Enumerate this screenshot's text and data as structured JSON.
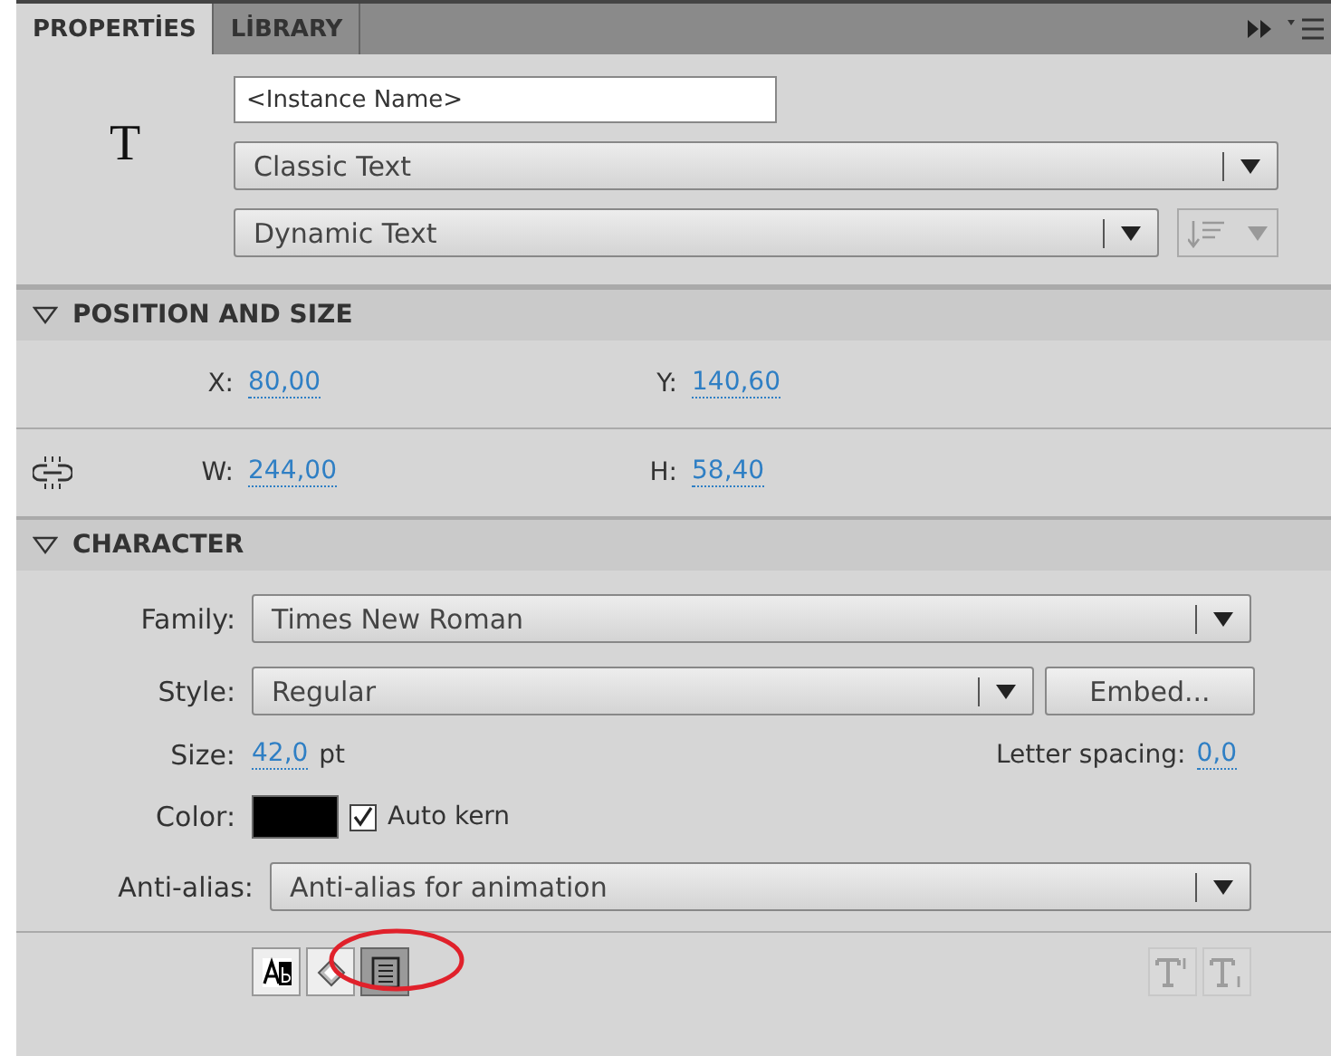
{
  "tabs": [
    {
      "label": "PROPERTİES",
      "selected": true
    },
    {
      "label": "LİBRARY",
      "selected": false
    }
  ],
  "header": {
    "icon_glyph": "T",
    "instance_name": {
      "placeholder": "<Instance Name>"
    },
    "text_engine": "Classic Text",
    "text_type": "Dynamic Text"
  },
  "sections": [
    {
      "kind": "position",
      "title": "POSITION AND SIZE",
      "expanded": true,
      "rows": [
        [
          {
            "label": "X:",
            "value": "80,00"
          },
          {
            "label": "Y:",
            "value": "140,60"
          }
        ],
        [
          {
            "label": "W:",
            "value": "244,00"
          },
          {
            "label": "H:",
            "value": "58,40"
          }
        ]
      ]
    },
    {
      "kind": "character",
      "title": "CHARACTER",
      "expanded": true,
      "family": {
        "label": "Family:",
        "value": "Times New Roman"
      },
      "style": {
        "label": "Style:",
        "value": "Regular",
        "button": "Embed..."
      },
      "size": {
        "label": "Size:",
        "value": "42,0",
        "unit": "pt"
      },
      "letter_spacing": {
        "label": "Letter spacing:",
        "value": "0,0"
      },
      "color": {
        "label": "Color:",
        "color": "#000000"
      },
      "auto_kern": {
        "label": "Auto kern",
        "checked": true
      },
      "anti_alias": {
        "label": "Anti-alias:",
        "value": "Anti-alias for animation"
      }
    }
  ],
  "text_toggles": [
    {
      "kind": "selectable",
      "selected": false
    },
    {
      "kind": "html",
      "selected": false
    },
    {
      "kind": "border",
      "selected": true
    }
  ],
  "script_toggles": [
    {
      "kind": "superscript",
      "disabled": true
    },
    {
      "kind": "subscript",
      "disabled": true
    }
  ],
  "annotation": {
    "kind": "ellipse",
    "color": "#e0212b"
  }
}
